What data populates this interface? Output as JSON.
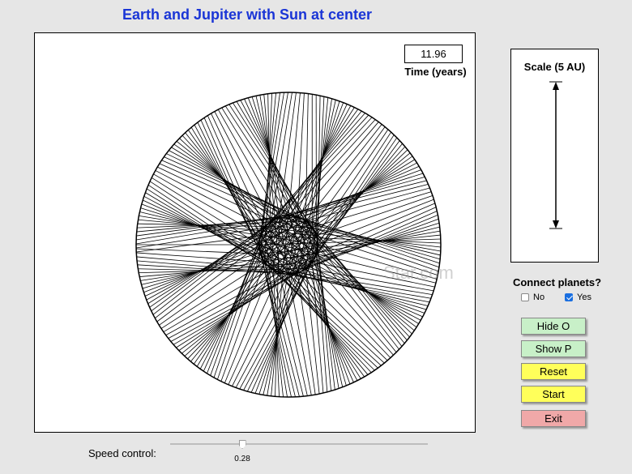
{
  "title": "Earth and Jupiter with Sun at center",
  "time": {
    "value": "11.96",
    "label": "Time (years)"
  },
  "watermark": "Star.com",
  "scale": {
    "label": "Scale (5 AU)"
  },
  "connect": {
    "label": "Connect planets?",
    "options": [
      {
        "label": "No",
        "checked": false
      },
      {
        "label": "Yes",
        "checked": true
      }
    ]
  },
  "buttons": {
    "hide_o": "Hide O",
    "show_p": "Show P",
    "reset": "Reset",
    "start": "Start",
    "exit": "Exit"
  },
  "speed": {
    "label": "Speed control:",
    "value": "0.28",
    "fraction": 0.28
  },
  "orbits": {
    "earth_period_years": 1.0,
    "jupiter_period_years": 11.86,
    "earth_radius_au": 1.0,
    "jupiter_radius_au": 5.2,
    "elapsed_years": 11.96,
    "line_interval_years": 0.05
  },
  "colors": {
    "title": "#1a35d6",
    "button_green": "#c8f0c8",
    "button_yellow": "#ffff5a",
    "button_red": "#f0a8a8",
    "checkbox_checked": "#1a6fe0"
  }
}
